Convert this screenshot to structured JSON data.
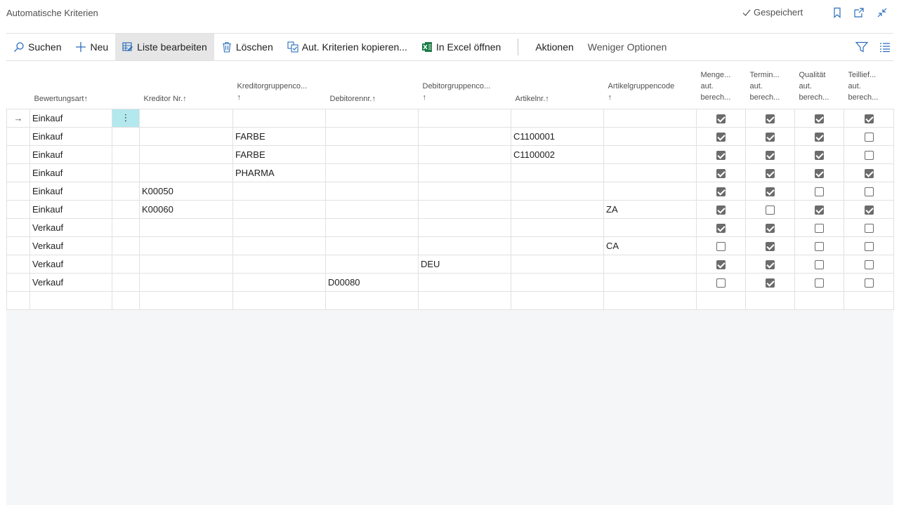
{
  "header": {
    "title": "Automatische Kriterien",
    "saved_label": "Gespeichert"
  },
  "actions": [
    {
      "label": "Suchen",
      "icon": "search-icon"
    },
    {
      "label": "Neu",
      "icon": "plus-icon"
    },
    {
      "label": "Liste bearbeiten",
      "icon": "edit-list-icon"
    },
    {
      "label": "Löschen",
      "icon": "trash-icon"
    },
    {
      "label": "Aut. Kriterien kopieren...",
      "icon": "copy-icon"
    },
    {
      "label": "In Excel öffnen",
      "icon": "excel-icon"
    },
    {
      "label": "Aktionen"
    },
    {
      "label": "Weniger Optionen"
    }
  ],
  "columns": [
    {
      "label": "Bewertungsart",
      "sort": "↑"
    },
    {
      "label": "Kreditor Nr.",
      "sort": "↑"
    },
    {
      "label": "Kreditorgruppenco...",
      "sort": "↑"
    },
    {
      "label": "Debitorennr.",
      "sort": "↑"
    },
    {
      "label": "Debitorgruppenco...",
      "sort": "↑"
    },
    {
      "label": "Artikelnr.",
      "sort": "↑"
    },
    {
      "label": "Artikelgruppencode",
      "sort": "↑"
    },
    {
      "l1": "Menge...",
      "l2": "aut.",
      "l3": "berech..."
    },
    {
      "l1": "Termin...",
      "l2": "aut.",
      "l3": "berech..."
    },
    {
      "l1": "Qualität",
      "l2": "aut.",
      "l3": "berech..."
    },
    {
      "l1": "Teillief...",
      "l2": "aut.",
      "l3": "berech..."
    }
  ],
  "rows": [
    {
      "art": "Einkauf",
      "kred": "",
      "kredgr": "",
      "deb": "",
      "debgr": "",
      "artnr": "",
      "artgr": "",
      "c": [
        true,
        true,
        true,
        true
      ]
    },
    {
      "art": "Einkauf",
      "kred": "",
      "kredgr": "FARBE",
      "deb": "",
      "debgr": "",
      "artnr": "C1100001",
      "artgr": "",
      "c": [
        true,
        true,
        true,
        false
      ]
    },
    {
      "art": "Einkauf",
      "kred": "",
      "kredgr": "FARBE",
      "deb": "",
      "debgr": "",
      "artnr": "C1100002",
      "artgr": "",
      "c": [
        true,
        true,
        true,
        false
      ]
    },
    {
      "art": "Einkauf",
      "kred": "",
      "kredgr": "PHARMA",
      "deb": "",
      "debgr": "",
      "artnr": "",
      "artgr": "",
      "c": [
        true,
        true,
        true,
        true
      ]
    },
    {
      "art": "Einkauf",
      "kred": "K00050",
      "kredgr": "",
      "deb": "",
      "debgr": "",
      "artnr": "",
      "artgr": "",
      "c": [
        true,
        true,
        false,
        false
      ]
    },
    {
      "art": "Einkauf",
      "kred": "K00060",
      "kredgr": "",
      "deb": "",
      "debgr": "",
      "artnr": "",
      "artgr": "ZA",
      "c": [
        true,
        false,
        true,
        true
      ]
    },
    {
      "art": "Verkauf",
      "kred": "",
      "kredgr": "",
      "deb": "",
      "debgr": "",
      "artnr": "",
      "artgr": "",
      "c": [
        true,
        true,
        false,
        false
      ]
    },
    {
      "art": "Verkauf",
      "kred": "",
      "kredgr": "",
      "deb": "",
      "debgr": "",
      "artnr": "",
      "artgr": "CA",
      "c": [
        false,
        true,
        false,
        false
      ]
    },
    {
      "art": "Verkauf",
      "kred": "",
      "kredgr": "",
      "deb": "",
      "debgr": "DEU",
      "artnr": "",
      "artgr": "",
      "c": [
        true,
        true,
        false,
        false
      ]
    },
    {
      "art": "Verkauf",
      "kred": "",
      "kredgr": "",
      "deb": "D00080",
      "debgr": "",
      "artnr": "",
      "artgr": "",
      "c": [
        false,
        true,
        false,
        false
      ]
    }
  ]
}
